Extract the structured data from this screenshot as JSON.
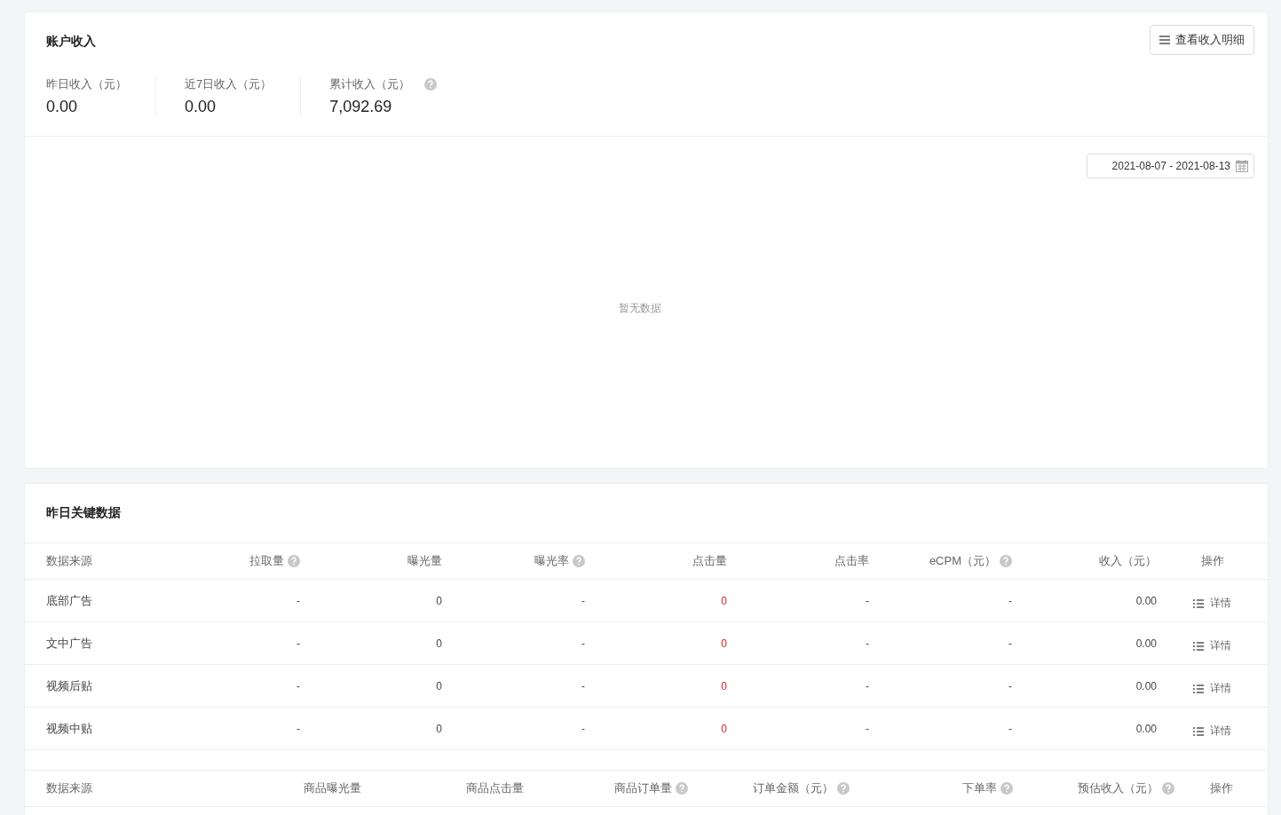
{
  "income": {
    "title": "账户收入",
    "detail_button": "查看收入明细",
    "stats": [
      {
        "label": "昨日收入（元）",
        "value": "0.00",
        "help": false
      },
      {
        "label": "近7日收入（元）",
        "value": "0.00",
        "help": false
      },
      {
        "label": "累计收入（元）",
        "value": "7,092.69",
        "help": true
      }
    ]
  },
  "chart": {
    "date_range": "2021-08-07 - 2021-08-13",
    "empty_text": "暂无数据"
  },
  "key_data": {
    "title": "昨日关键数据",
    "table": {
      "columns": [
        {
          "label": "数据来源",
          "help": false,
          "highlight": false
        },
        {
          "label": "拉取量",
          "help": true,
          "highlight": false
        },
        {
          "label": "曝光量",
          "help": false,
          "highlight": false
        },
        {
          "label": "曝光率",
          "help": true,
          "highlight": false
        },
        {
          "label": "点击量",
          "help": false,
          "highlight": true
        },
        {
          "label": "点击率",
          "help": false,
          "highlight": false
        },
        {
          "label": "eCPM（元）",
          "help": true,
          "highlight": false
        },
        {
          "label": "收入（元）",
          "help": false,
          "highlight": false
        },
        {
          "label": "操作",
          "help": false,
          "highlight": false
        }
      ],
      "rows": [
        {
          "cells": [
            "底部广告",
            "-",
            "0",
            "-",
            "0",
            "-",
            "-",
            "0.00"
          ],
          "action": "详情"
        },
        {
          "cells": [
            "文中广告",
            "-",
            "0",
            "-",
            "0",
            "-",
            "-",
            "0.00"
          ],
          "action": "详情"
        },
        {
          "cells": [
            "视频后贴",
            "-",
            "0",
            "-",
            "0",
            "-",
            "-",
            "0.00"
          ],
          "action": "详情"
        },
        {
          "cells": [
            "视频中贴",
            "-",
            "0",
            "-",
            "0",
            "-",
            "-",
            "0.00"
          ],
          "action": "详情"
        }
      ]
    },
    "table_2": {
      "columns": [
        {
          "label": "数据来源",
          "help": false
        },
        {
          "label": "商品曝光量",
          "help": false
        },
        {
          "label": "商品点击量",
          "help": false
        },
        {
          "label": "商品订单量",
          "help": true
        },
        {
          "label": "订单金额（元）",
          "help": true
        },
        {
          "label": "下单率",
          "help": true
        },
        {
          "label": "预估收入（元）",
          "help": true
        },
        {
          "label": "操作",
          "help": false
        }
      ]
    }
  }
}
